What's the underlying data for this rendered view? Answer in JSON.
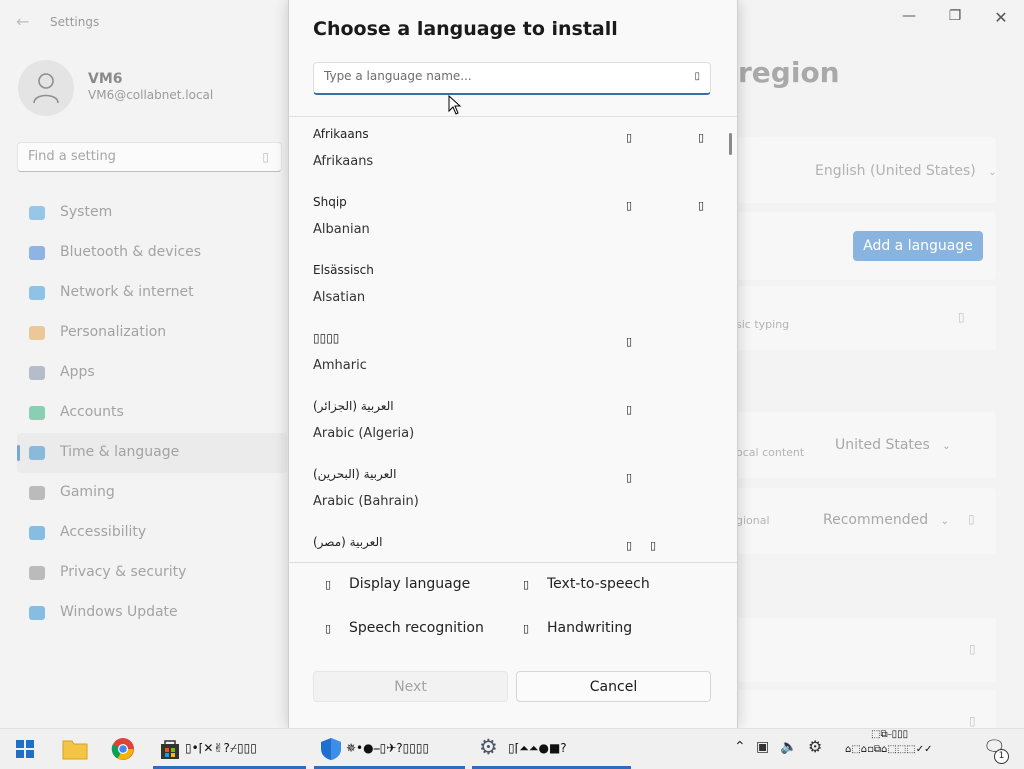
{
  "settings": {
    "app_title": "Settings",
    "profile": {
      "name": "VM6",
      "email": "VM6@collabnet.local"
    },
    "search_placeholder": "Find a setting",
    "nav": [
      {
        "label": "System",
        "icon": "monitor-icon",
        "color": "#4aa3df"
      },
      {
        "label": "Bluetooth & devices",
        "icon": "bluetooth-icon",
        "color": "#3a7fd5"
      },
      {
        "label": "Network & internet",
        "icon": "wifi-icon",
        "color": "#3a9bd9"
      },
      {
        "label": "Personalization",
        "icon": "brush-icon",
        "color": "#e5a24b"
      },
      {
        "label": "Apps",
        "icon": "apps-icon",
        "color": "#7f8fa6"
      },
      {
        "label": "Accounts",
        "icon": "person-icon",
        "color": "#2fb37a"
      },
      {
        "label": "Time & language",
        "icon": "globe-clock-icon",
        "color": "#3a8fd0",
        "active": true
      },
      {
        "label": "Gaming",
        "icon": "gamepad-icon",
        "color": "#8c8c8c"
      },
      {
        "label": "Accessibility",
        "icon": "accessibility-icon",
        "color": "#2d8fd5"
      },
      {
        "label": "Privacy & security",
        "icon": "shield-icon",
        "color": "#8c8c8c"
      },
      {
        "label": "Windows Update",
        "icon": "update-icon",
        "color": "#2d8fd5"
      }
    ],
    "page_title_partial": "region",
    "display_language_value": "English (United States)",
    "add_language_label": "Add a language",
    "typing_partial": "sic typing",
    "country_partial": "ocal content",
    "country_value": "United States",
    "regional_partial": "gional",
    "regional_value": "Recommended"
  },
  "dialog": {
    "title": "Choose a language to install",
    "search_placeholder": "Type a language name...",
    "languages": [
      {
        "native": "Afrikaans",
        "english": "Afrikaans",
        "features": [
          "display",
          "handwriting"
        ]
      },
      {
        "native": "Shqip",
        "english": "Albanian",
        "features": [
          "display",
          "handwriting"
        ]
      },
      {
        "native": "Elsässisch",
        "english": "Alsatian",
        "features": []
      },
      {
        "native": "▯▯▯▯",
        "english": "Amharic",
        "features": [
          "display"
        ]
      },
      {
        "native": "العربية (الجزائر)",
        "english": "Arabic (Algeria)",
        "features": [
          "display"
        ]
      },
      {
        "native": "العربية (البحرين)",
        "english": "Arabic (Bahrain)",
        "features": [
          "display"
        ]
      },
      {
        "native": "العربية (مصر)",
        "english": "",
        "features": [
          "display",
          "tts"
        ]
      }
    ],
    "legend": {
      "display": "Display language",
      "tts": "Text-to-speech",
      "speech": "Speech recognition",
      "handwriting": "Handwriting"
    },
    "next_label": "Next",
    "cancel_label": "Cancel"
  },
  "taskbar": {
    "apps": [
      {
        "name": "store",
        "text": "▯•⌈✕✌?⌿▯▯▯"
      },
      {
        "name": "defender",
        "text": "✵•●⎯▯✈?▯▯▯▯"
      },
      {
        "name": "settings",
        "text": "▯⌈⏶⏶●■?"
      }
    ],
    "clock_top": "⬚⧉⎯▯▯▯",
    "clock_bottom": "⌂⬚⌂▫⧉⌂⬚⬚⬚✓✓",
    "notification_count": "1"
  }
}
